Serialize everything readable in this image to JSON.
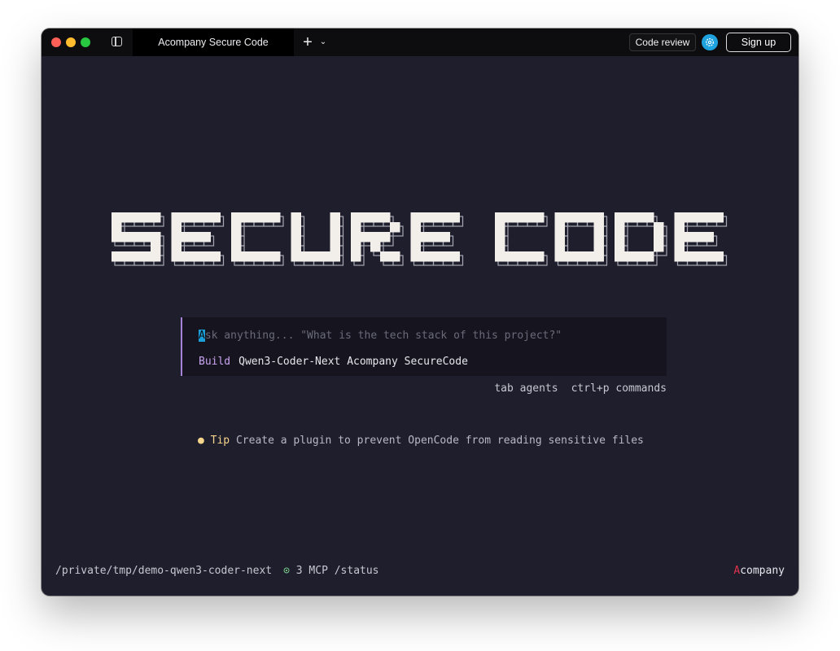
{
  "window": {
    "tab_title": "Acompany Secure Code",
    "new_tab_icon": "plus-icon",
    "tab_menu_icon": "chevron-down-icon",
    "sidebar_icon": "sidebar-toggle-icon",
    "settings_icon": "gear-icon"
  },
  "header": {
    "code_review_label": "Code review",
    "signup_label": "Sign up"
  },
  "logo": {
    "text": "SECURE CODE"
  },
  "prompt": {
    "placeholder_first": "A",
    "placeholder_rest": "sk anything... \"What is the tech stack of this project?\"",
    "mode": "Build",
    "model": "Qwen3-Coder-Next Acompany SecureCode"
  },
  "hints": {
    "agents": "tab agents",
    "commands": "ctrl+p commands"
  },
  "tip": {
    "label": "Tip",
    "text": "Create a plugin to prevent OpenCode from reading sensitive files"
  },
  "footer": {
    "path": "/private/tmp/demo-qwen3-coder-next",
    "mcp_status": "3 MCP /status",
    "brand_first": "A",
    "brand_rest": "company"
  },
  "colors": {
    "background": "#1f1e2d",
    "titlebar": "#0d0d10",
    "accent_purple": "#a584d8",
    "cursor_blue": "#1a9fd8",
    "tip_yellow": "#f6d58d",
    "mcp_green": "#7fd88f",
    "brand_red": "#e0334b"
  }
}
